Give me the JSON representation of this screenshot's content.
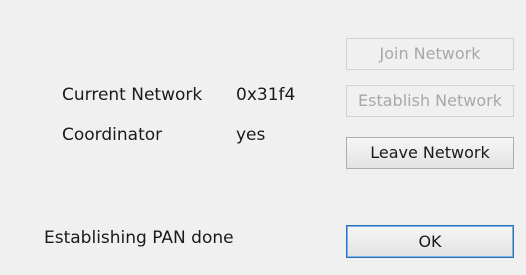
{
  "labels": {
    "current_network_label": "Current Network",
    "current_network_value": "0x31f4",
    "coordinator_label": "Coordinator",
    "coordinator_value": "yes",
    "status": "Establishing PAN done"
  },
  "buttons": {
    "join_network": "Join Network",
    "establish_network": "Establish Network",
    "leave_network": "Leave Network",
    "ok": "OK"
  }
}
